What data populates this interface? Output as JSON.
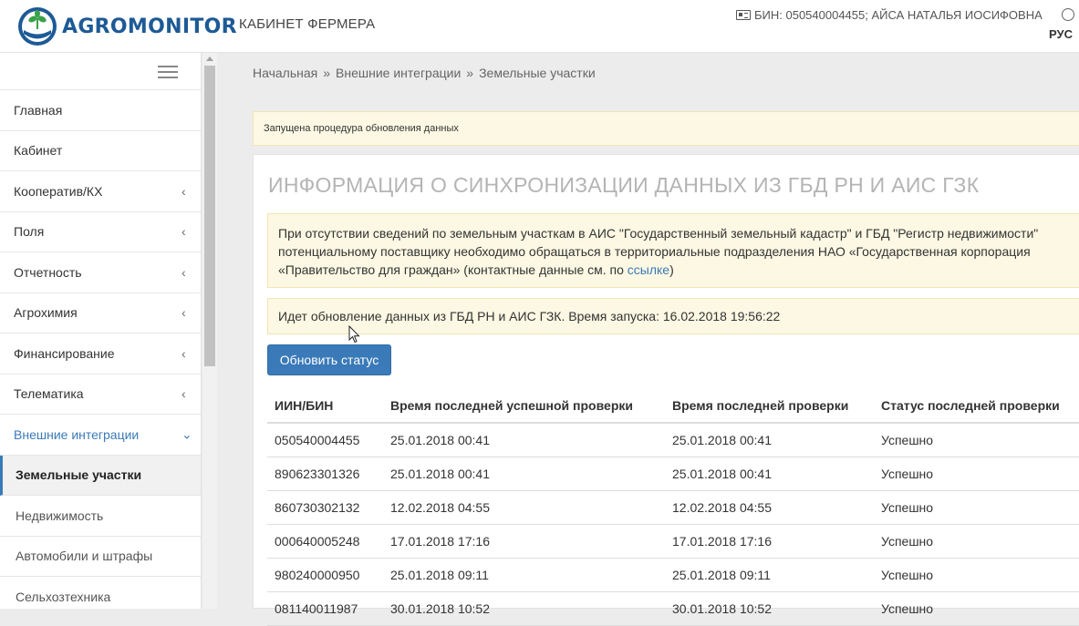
{
  "header": {
    "logo_text": "AGROMONITOR",
    "cabinet_title": "КАБИНЕТ ФЕРМЕРА",
    "user_info": "БИН: 050540004455; АЙСА НАТАЛЬЯ ИОСИФОВНА",
    "language": "РУС"
  },
  "sidebar": {
    "items": [
      {
        "label": "Главная",
        "has_submenu": false
      },
      {
        "label": "Кабинет",
        "has_submenu": false
      },
      {
        "label": "Кооператив/КХ",
        "has_submenu": true,
        "chevron": "‹"
      },
      {
        "label": "Поля",
        "has_submenu": true,
        "chevron": "‹"
      },
      {
        "label": "Отчетность",
        "has_submenu": true,
        "chevron": "‹"
      },
      {
        "label": "Агрохимия",
        "has_submenu": true,
        "chevron": "‹"
      },
      {
        "label": "Финансирование",
        "has_submenu": true,
        "chevron": "‹"
      },
      {
        "label": "Телематика",
        "has_submenu": true,
        "chevron": "‹"
      },
      {
        "label": "Внешние интеграции",
        "has_submenu": true,
        "open": true,
        "chevron": "⌄"
      }
    ],
    "subitems": [
      {
        "label": "Земельные участки",
        "active": true
      },
      {
        "label": "Недвижимость"
      },
      {
        "label": "Автомобили и штрафы"
      },
      {
        "label": "Сельхозтехника"
      }
    ]
  },
  "breadcrumb": {
    "items": [
      "Начальная",
      "Внешние интеграции",
      "Земельные участки"
    ],
    "separator": "»"
  },
  "alert_top": "Запущена процедура обновления данных",
  "panel": {
    "title": "ИНФОРМАЦИЯ О СИНХРОНИЗАЦИИ ДАННЫХ ИЗ ГБД РН И АИС ГЗК",
    "info_line1": "При отсутствии сведений по земельным участкам в АИС \"Государственный земельный кадастр\" и ГБД \"Регистр недвижимости\"",
    "info_line2": "потенциальному поставщику необходимо обращаться в территориальные подразделения НАО «Государственная корпорация",
    "info_line3_prefix": "«Правительство для граждан» (контактные данные см. по ",
    "info_link": "ссылке",
    "info_line3_suffix": ")",
    "status_text": "Идет обновление данных из ГБД РН и АИС ГЗК. Время запуска: 16.02.2018 19:56:22",
    "refresh_button": "Обновить статус"
  },
  "table": {
    "columns": [
      "ИИН/БИН",
      "Время последней успешной проверки",
      "Время последней проверки",
      "Статус последней проверки"
    ],
    "rows": [
      [
        "050540004455",
        "25.01.2018 00:41",
        "25.01.2018 00:41",
        "Успешно"
      ],
      [
        "890623301326",
        "25.01.2018 00:41",
        "25.01.2018 00:41",
        "Успешно"
      ],
      [
        "860730302132",
        "12.02.2018 04:55",
        "12.02.2018 04:55",
        "Успешно"
      ],
      [
        "000640005248",
        "17.01.2018 17:16",
        "17.01.2018 17:16",
        "Успешно"
      ],
      [
        "980240000950",
        "25.01.2018 09:11",
        "25.01.2018 09:11",
        "Успешно"
      ],
      [
        "081140011987",
        "30.01.2018 10:52",
        "30.01.2018 10:52",
        "Успешно"
      ]
    ]
  },
  "colors": {
    "accent": "#3a7ab8",
    "alert_bg": "#fcf8e3",
    "title_gray": "#b4b4b4"
  }
}
